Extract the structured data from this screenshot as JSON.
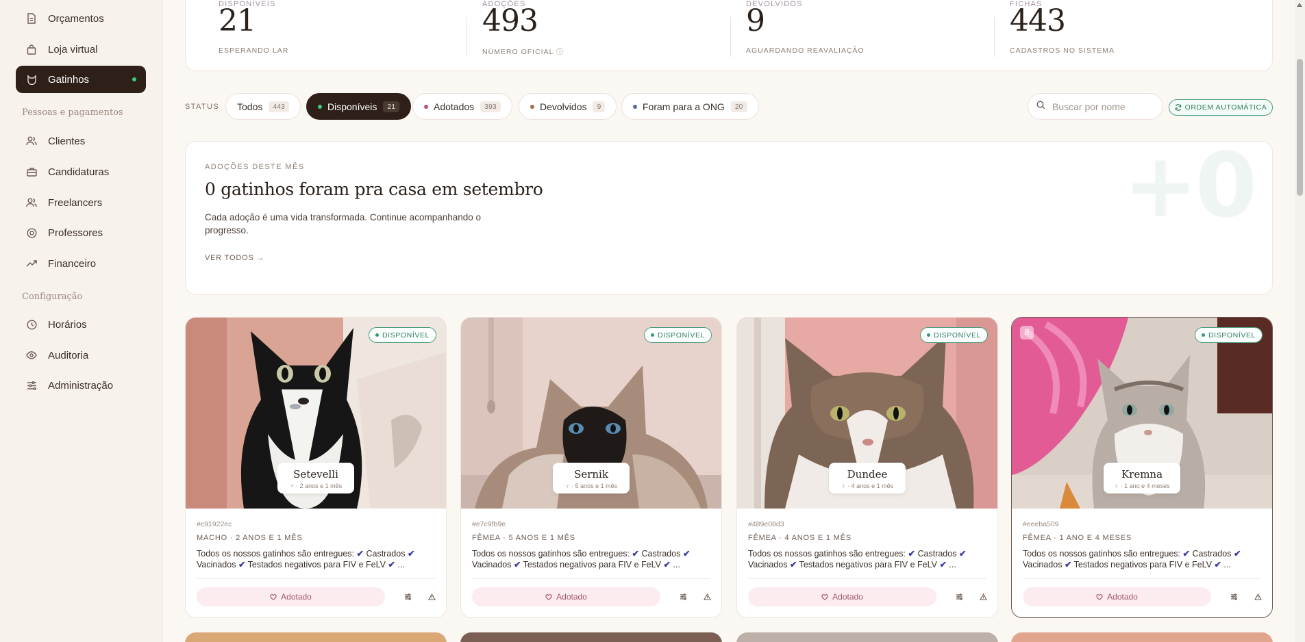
{
  "sidebar": {
    "items_top": [
      {
        "label": "Orçamentos",
        "icon": "file-icon"
      },
      {
        "label": "Loja virtual",
        "icon": "shopping-bag-icon"
      },
      {
        "label": "Gatinhos",
        "icon": "cat-icon",
        "active": true
      }
    ],
    "section_people": "Pessoas e pagamentos",
    "items_people": [
      {
        "label": "Clientes",
        "icon": "users-icon"
      },
      {
        "label": "Candidaturas",
        "icon": "briefcase-icon"
      },
      {
        "label": "Freelancers",
        "icon": "users-icon"
      },
      {
        "label": "Professores",
        "icon": "badge-icon"
      },
      {
        "label": "Financeiro",
        "icon": "trending-up-icon"
      }
    ],
    "section_config": "Configuração",
    "items_config": [
      {
        "label": "Horários",
        "icon": "clock-icon"
      },
      {
        "label": "Auditoria",
        "icon": "eye-icon"
      },
      {
        "label": "Administração",
        "icon": "sliders-icon"
      }
    ]
  },
  "stats": [
    {
      "label": "DISPONÍVEIS",
      "value": "21",
      "sub": "ESPERANDO LAR"
    },
    {
      "label": "ADOÇÕES",
      "value": "493",
      "sub": "NÚMERO OFICIAL ⓘ"
    },
    {
      "label": "DEVOLVIDOS",
      "value": "9",
      "sub": "AGUARDANDO REAVALIAÇÃO"
    },
    {
      "label": "FICHAS",
      "value": "443",
      "sub": "CADASTROS NO SISTEMA"
    }
  ],
  "filters": {
    "status_label": "STATUS",
    "chips": [
      {
        "label": "Todos",
        "count": "443"
      },
      {
        "label": "Disponíveis",
        "count": "21",
        "active": true,
        "dot": "#3ecb7a"
      },
      {
        "label": "Adotados",
        "count": "393",
        "dot": "#c0506e"
      },
      {
        "label": "Devolvidos",
        "count": "9",
        "dot": "#a0704a"
      },
      {
        "label": "Foram para a ONG",
        "count": "20",
        "dot": "#5a6a9a"
      }
    ],
    "search_placeholder": "Buscar por nome",
    "order_label": "ORDEM AUTOMÁTICA"
  },
  "adoptions": {
    "eyebrow": "ADOÇÕES DESTE MÊS",
    "title": "0 gatinhos foram pra casa em setembro",
    "description": "Cada adoção é uma vida transformada. Continue acompanhando o progresso.",
    "link": "VER TODOS →",
    "big_number": "+0"
  },
  "cats": [
    {
      "name": "Setevelli",
      "age_short": "♂ · 2 anos e 1 mês",
      "id": "#c91922ec",
      "meta": "MACHO · 2 ANOS E 1 MÊS",
      "badge": "DISPONÍVEL",
      "desc_intro": "Todos os nossos gatinhos são entregues:",
      "desc_items": [
        "Castrados",
        "Vacinados",
        "Testados negativos para FIV e FeLV",
        "..."
      ],
      "button": "Adotado"
    },
    {
      "name": "Sernik",
      "age_short": "♀ · 5 anos e 1 mês",
      "id": "#e7c9fb9e",
      "meta": "FÊMEA · 5 ANOS E 1 MÊS",
      "badge": "DISPONÍVEL",
      "desc_intro": "Todos os nossos gatinhos são entregues:",
      "desc_items": [
        "Castrados",
        "Vacinados",
        "Testados negativos para FIV e FeLV",
        "..."
      ],
      "button": "Adotado"
    },
    {
      "name": "Dundee",
      "age_short": "♀ · 4 anos e 1 mês",
      "id": "#489e08d3",
      "meta": "FÊMEA · 4 ANOS E 1 MÊS",
      "badge": "DISPONÍVEL",
      "desc_intro": "Todos os nossos gatinhos são entregues:",
      "desc_items": [
        "Castrados",
        "Vacinados",
        "Testados negativos para FIV e FeLV",
        "..."
      ],
      "button": "Adotado"
    },
    {
      "name": "Kremna",
      "age_short": "♀ · 1 ano e 4 meses",
      "id": "#eeeba509",
      "meta": "FÊMEA · 1 ANO E 4 MESES",
      "badge": "DISPONÍVEL",
      "desc_intro": "Todos os nossos gatinhos são entregues:",
      "desc_items": [
        "Castrados",
        "Vacinados",
        "Testados negativos para FIV e FeLV",
        "..."
      ],
      "button": "Adotado"
    }
  ],
  "colors": {
    "accent_dark": "#2e2019",
    "available_green": "#2f7c60",
    "adopted_pink": "#a0596e",
    "background": "#fbf7f3"
  }
}
